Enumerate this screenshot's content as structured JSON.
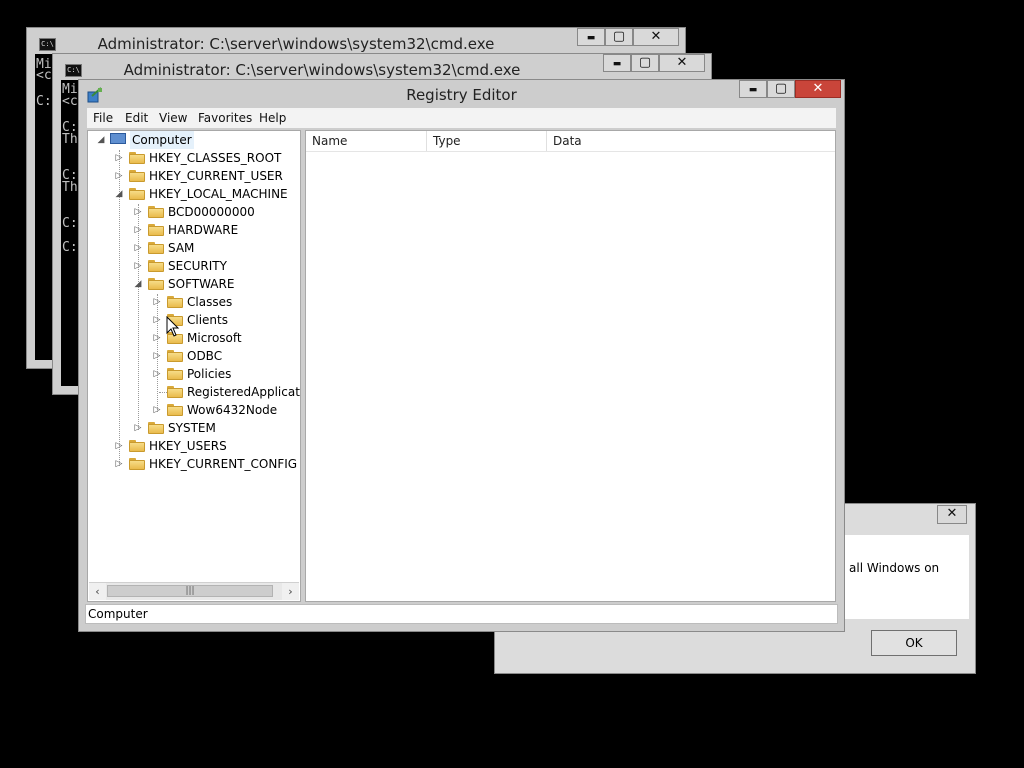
{
  "cmd1": {
    "title": "Administrator: C:\\server\\windows\\system32\\cmd.exe",
    "lines": [
      "Mi",
      "<c",
      "",
      "C:"
    ]
  },
  "cmd2": {
    "title": "Administrator: C:\\server\\windows\\system32\\cmd.exe",
    "lines": [
      "Mi",
      "<c",
      "",
      "C:",
      "Th",
      "",
      "C:",
      "Th",
      "",
      "C:",
      "",
      "C:"
    ]
  },
  "regedit": {
    "title": "Registry Editor",
    "menu": [
      "File",
      "Edit",
      "View",
      "Favorites",
      "Help"
    ],
    "columns": [
      "Name",
      "Type",
      "Data"
    ],
    "status": "Computer",
    "tree": {
      "root": "Computer",
      "hkcr": "HKEY_CLASSES_ROOT",
      "hkcu": "HKEY_CURRENT_USER",
      "hklm": "HKEY_LOCAL_MACHINE",
      "bcd": "BCD00000000",
      "hardware": "HARDWARE",
      "sam": "SAM",
      "security": "SECURITY",
      "software": "SOFTWARE",
      "classes": "Classes",
      "clients": "Clients",
      "microsoft": "Microsoft",
      "odbc": "ODBC",
      "policies": "Policies",
      "regapps": "RegisteredApplications",
      "wow": "Wow6432Node",
      "system": "SYSTEM",
      "hku": "HKEY_USERS",
      "hkcc": "HKEY_CURRENT_CONFIG"
    }
  },
  "dialog": {
    "message": "all Windows on",
    "ok_label": "OK"
  },
  "icons": {
    "minimize": "▬",
    "maximize": "▢",
    "close": "✕",
    "expanded": "◢",
    "collapsed": "▷",
    "scroll_left": "‹",
    "scroll_right": "›"
  }
}
